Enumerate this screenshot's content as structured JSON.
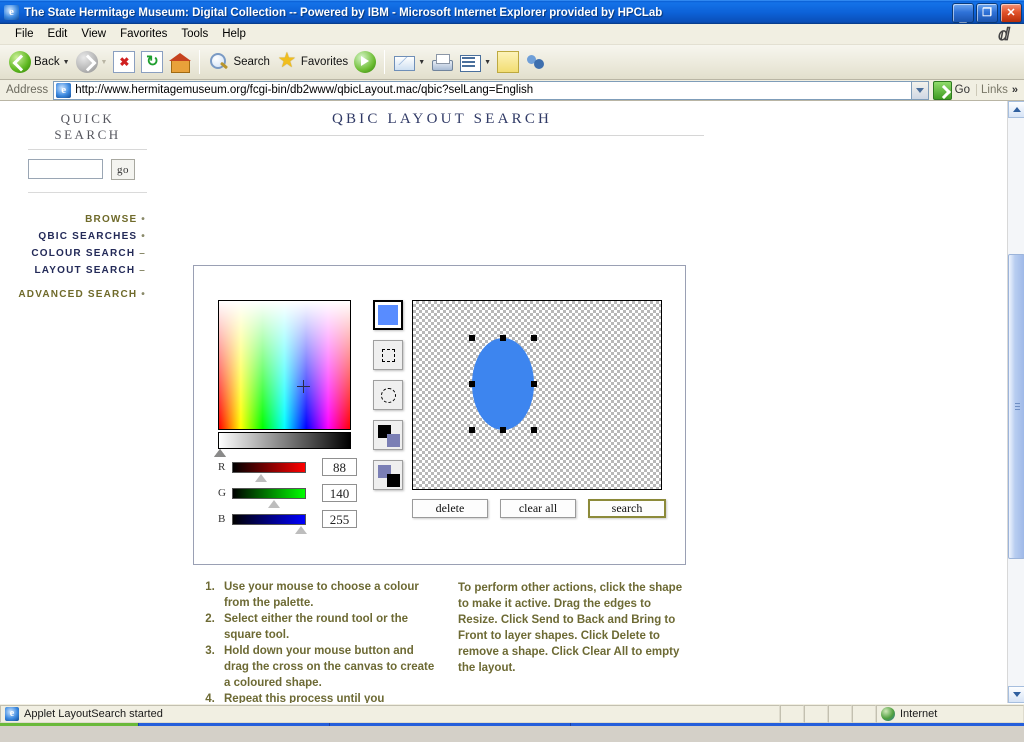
{
  "window": {
    "title": "The State Hermitage Museum: Digital Collection -- Powered by IBM - Microsoft Internet Explorer provided by HPCLab",
    "minimize_label": "_",
    "restore_label": "❐",
    "close_label": "✕"
  },
  "menu": {
    "items": [
      "File",
      "Edit",
      "View",
      "Favorites",
      "Tools",
      "Help"
    ]
  },
  "toolbar": {
    "back_label": "Back",
    "search_label": "Search",
    "favorites_label": "Favorites",
    "icons": [
      "back-icon",
      "forward-icon",
      "stop-icon",
      "refresh-icon",
      "home-icon",
      "search-icon",
      "favorites-star-icon",
      "media-icon",
      "mail-icon",
      "print-icon",
      "edit-icon",
      "note-icon",
      "messenger-icon"
    ]
  },
  "address": {
    "label": "Address",
    "url": "http://www.hermitagemuseum.org/fcgi-bin/db2www/qbicLayout.mac/qbic?selLang=English",
    "go_label": "Go",
    "links_label": "Links",
    "chevron": "»"
  },
  "sidebar": {
    "quick_search_title": "QUICK SEARCH",
    "quick_search_value": "",
    "quick_search_placeholder": "",
    "go_label": "go",
    "nav": [
      {
        "label": "BROWSE",
        "marker": "•",
        "style": "olive"
      },
      {
        "label": "QBIC SEARCHES",
        "marker": "•",
        "style": "navy"
      },
      {
        "label": "COLOUR SEARCH",
        "marker": "–",
        "style": "navy"
      },
      {
        "label": "LAYOUT SEARCH",
        "marker": "–",
        "style": "navy"
      },
      {
        "label": "ADVANCED SEARCH",
        "marker": "•",
        "style": "olive"
      }
    ]
  },
  "main": {
    "title": "QBIC LAYOUT SEARCH",
    "applet": {
      "current_colour_hex": "#588cff",
      "rgb": {
        "r_label": "R",
        "r_value": "88",
        "g_label": "G",
        "g_value": "140",
        "b_label": "B",
        "b_value": "255"
      },
      "tools": [
        {
          "name": "colour-swatch",
          "selected": true
        },
        {
          "name": "square-tool",
          "selected": false
        },
        {
          "name": "round-tool",
          "selected": false
        },
        {
          "name": "send-to-back",
          "selected": false
        },
        {
          "name": "bring-to-front",
          "selected": false
        }
      ],
      "canvas": {
        "shape_type": "ellipse",
        "shape_colour": "#3d85ef",
        "selected": true,
        "handle_count": 8
      },
      "buttons": [
        {
          "label": "delete",
          "highlight": false
        },
        {
          "label": "clear all",
          "highlight": false
        },
        {
          "label": "search",
          "highlight": true
        }
      ]
    },
    "instructions_list": [
      "Use your mouse to choose a colour from the palette.",
      "Select either the round tool or the square tool.",
      "Hold down your mouse button and drag the cross on the canvas to create a coloured shape.",
      "Repeat this process until you complete your custom layout. When you're ready, click Search."
    ],
    "instructions_right": "To perform other actions, click the shape to make it active. Drag the edges to Resize. Click Send to Back and Bring to Front to layer shapes. Click Delete to remove a shape. Click Clear All to empty the layout."
  },
  "status": {
    "message": "Applet LayoutSearch started",
    "zone": "Internet"
  },
  "colors": {
    "titlebar_blue": "#0d62d8",
    "accent_navy": "#232a58",
    "accent_olive": "#6d6a34",
    "shape_blue": "#3d85ef"
  }
}
